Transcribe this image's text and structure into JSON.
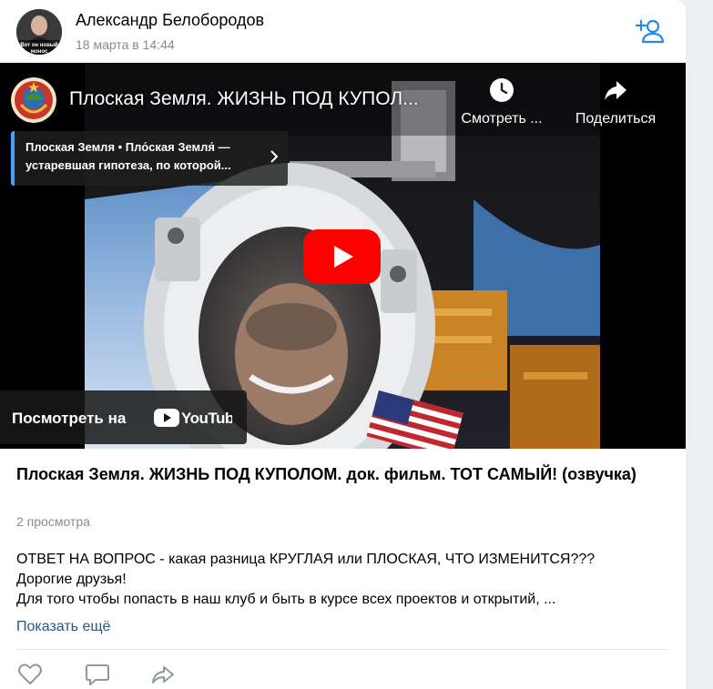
{
  "post": {
    "author": "Александр Белобородов",
    "date": "18 марта в 14:44",
    "avatar_text": "Вот он новый монос",
    "title": "Плоская Земля. ЖИЗНЬ ПОД КУПОЛОМ. док. фильм. ТОТ САМЫЙ! (озвучка)",
    "views": "2 просмотра",
    "description_lines": [
      "ОТВЕТ НА ВОПРОС - какая разница КРУГЛАЯ или ПЛОСКАЯ,  ЧТО ИЗМЕНИТСЯ???",
      "Дорогие друзья!",
      "Для того чтобы попасть в наш клуб и быть в курсе всех проектов и открытий, ..."
    ],
    "show_more": "Показать ещё"
  },
  "video": {
    "title": "Плоская Земля. ЖИЗНЬ ПОД КУПОЛ...",
    "watch_later_label": "Смотреть ...",
    "share_label": "Поделиться",
    "playlist_line1": "Плоская Земля • Пло́ская Земля́ —",
    "playlist_line2": "устаревшая гипотеза, по которой...",
    "watch_on_label": "Посмотреть на",
    "youtube_wordmark": "YouTube"
  },
  "icons": {
    "add_friend": "add-friend-icon",
    "like": "heart-icon",
    "comment": "comment-icon",
    "share": "share-icon",
    "watch_later": "clock-icon",
    "video_share": "share-arrow-icon",
    "play": "play-icon"
  },
  "colors": {
    "accent": "#2688eb",
    "link": "#2a5885",
    "muted": "#818c99",
    "youtube_red": "#ff0000",
    "background": "#edeef0"
  }
}
